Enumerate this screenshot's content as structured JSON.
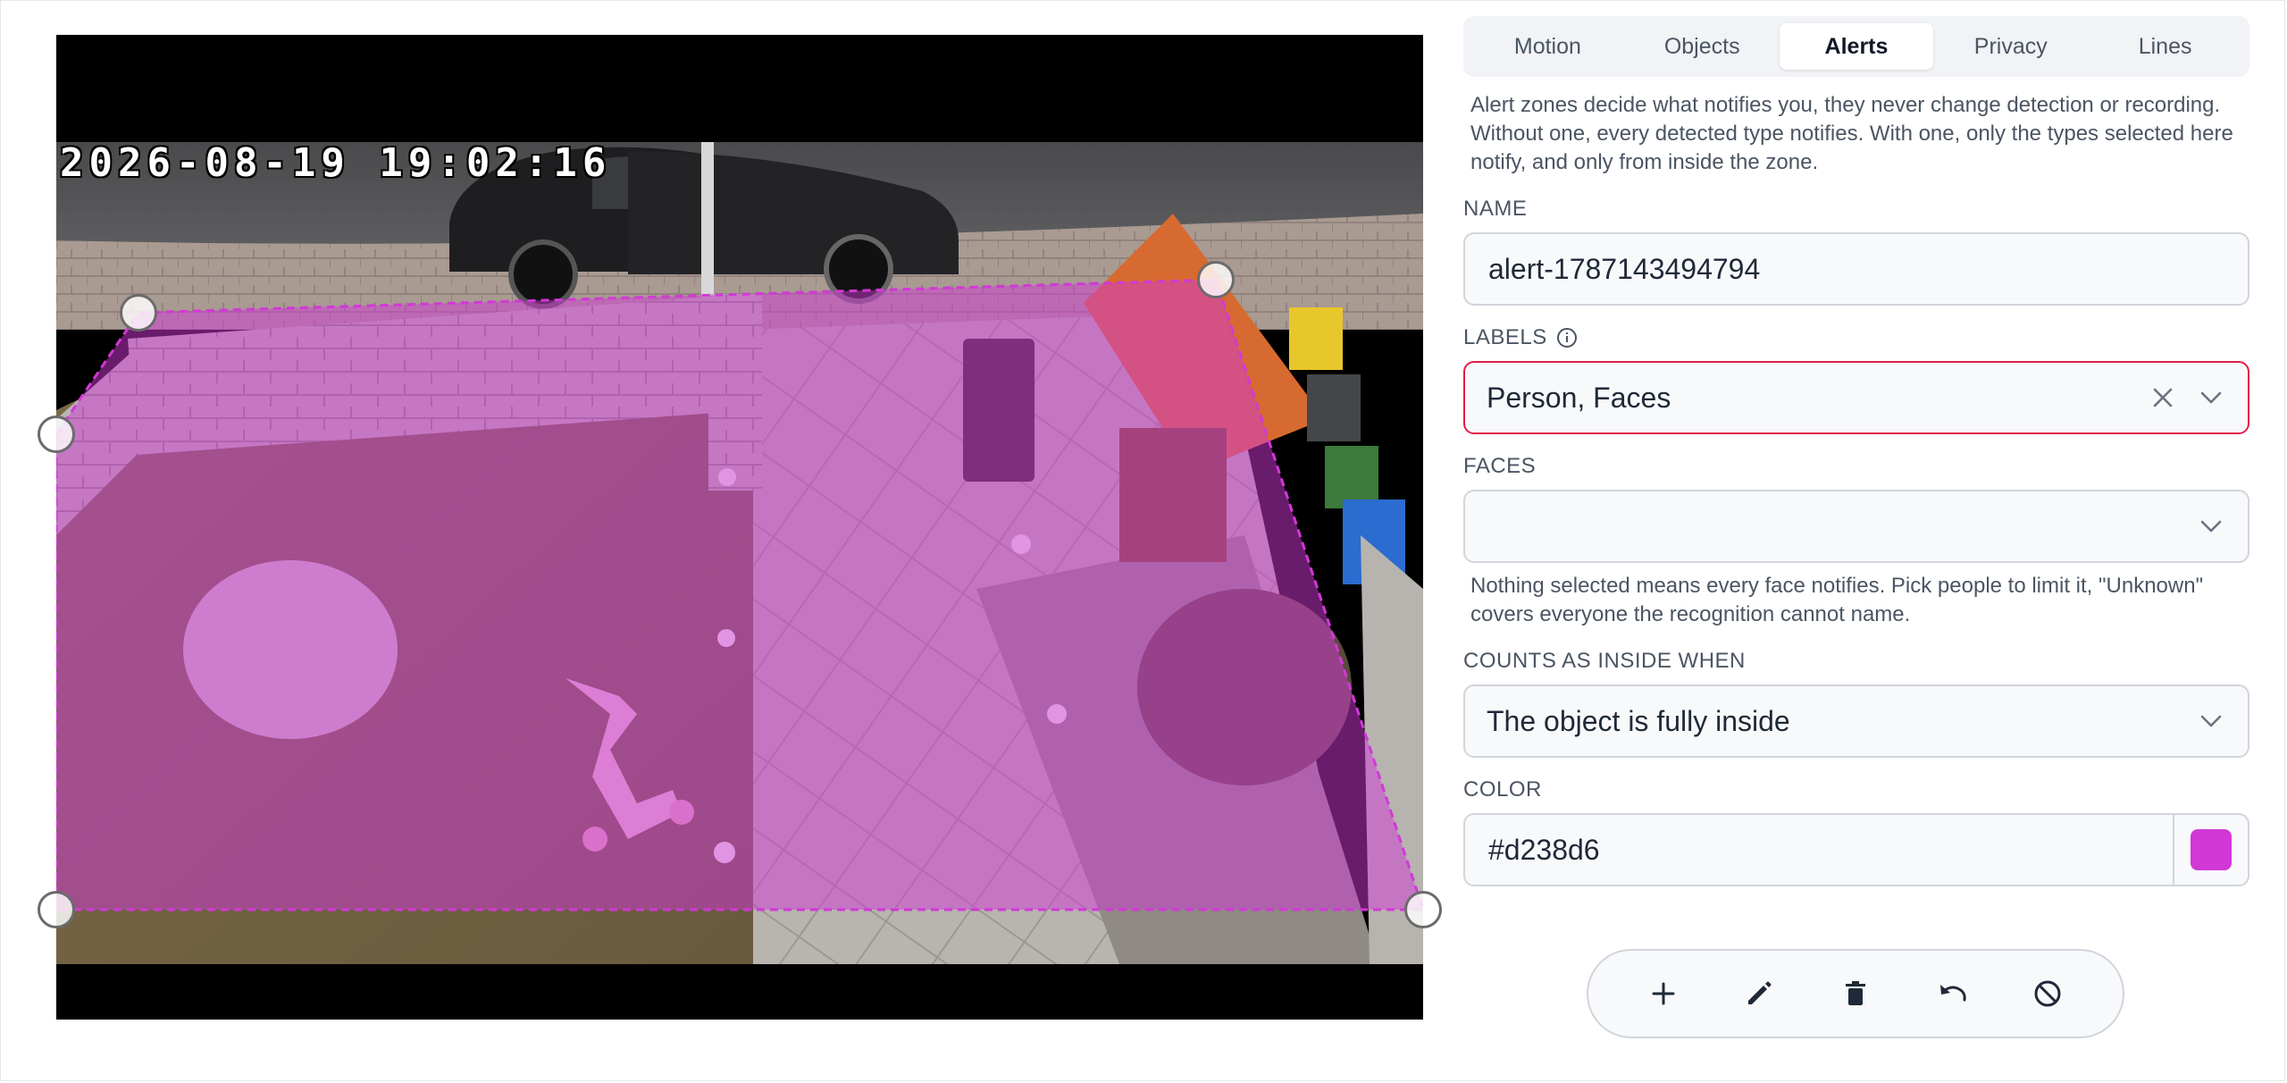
{
  "tabs": [
    {
      "label": "Motion",
      "active": false
    },
    {
      "label": "Objects",
      "active": false
    },
    {
      "label": "Alerts",
      "active": true
    },
    {
      "label": "Privacy",
      "active": false
    },
    {
      "label": "Lines",
      "active": false
    }
  ],
  "alerts_help": "Alert zones decide what notifies you, they never change detection or recording. Without one, every detected type notifies. With one, only the types selected here notify, and only from inside the zone.",
  "name_field": {
    "label": "NAME",
    "value": "alert-1787143494794"
  },
  "labels_field": {
    "label": "LABELS",
    "value": "Person, Faces",
    "info_icon": "info-icon",
    "clear_icon": "close-icon",
    "expand_icon": "chevron-down-icon"
  },
  "faces_field": {
    "label": "FACES",
    "value": "",
    "expand_icon": "chevron-down-icon"
  },
  "faces_help": "Nothing selected means every face notifies. Pick people to limit it, \"Unknown\" covers everyone the recognition cannot name.",
  "inside_field": {
    "label": "COUNTS AS INSIDE WHEN",
    "value": "The object is fully inside",
    "expand_icon": "chevron-down-icon"
  },
  "color_field": {
    "label": "COLOR",
    "value": "#d238d6",
    "swatch": "#d238d6"
  },
  "camera": {
    "timestamp": "2026-08-19  19:02:16"
  },
  "zone": {
    "fill": "#d238d6",
    "outline": "#d238d6"
  },
  "toolbar_icons": [
    "plus-icon",
    "pencil-icon",
    "trash-icon",
    "undo-icon",
    "disable-icon"
  ],
  "colors": {
    "accent_error": "#e11d48",
    "panel_bg": "#f8f9fb",
    "text_muted": "#4b5563"
  }
}
